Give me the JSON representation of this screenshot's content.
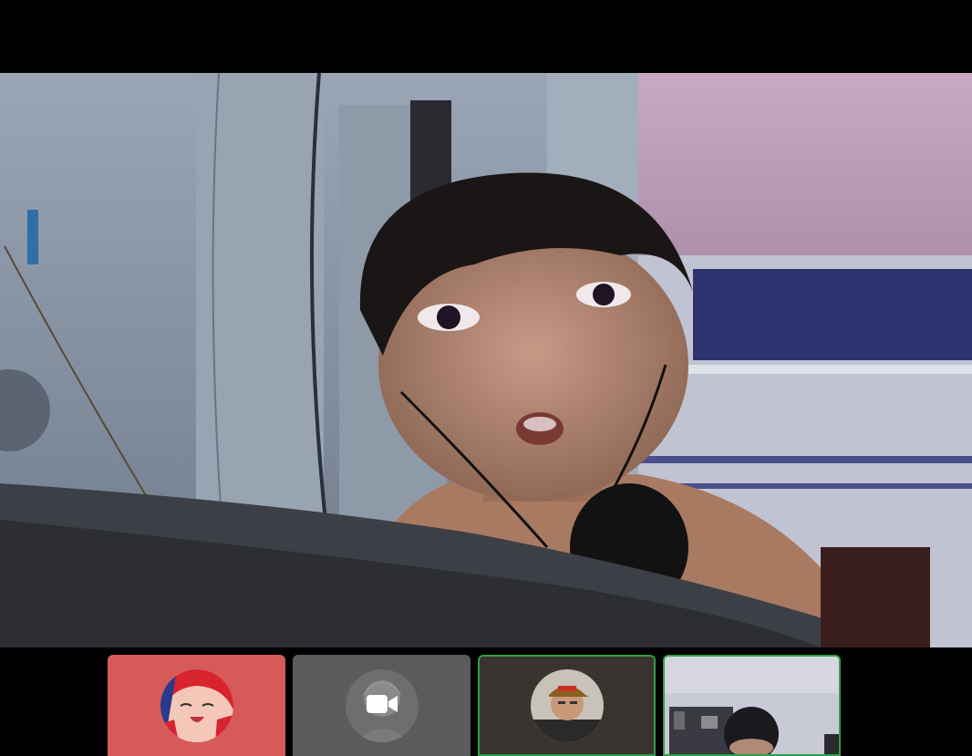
{
  "meeting": {
    "main_participant": "camera-feed-main",
    "participants": [
      {
        "id": "p1",
        "tile_color": "#d65a5a",
        "avatar": "anime-girl-avatar",
        "camera_on": false,
        "speaking": false
      },
      {
        "id": "p2",
        "tile_color": "#5b5b5b",
        "avatar": "grayscale-avatar",
        "camera_on": false,
        "camera_icon": "video-camera-icon",
        "speaking": false
      },
      {
        "id": "p3",
        "tile_color": "#3a3430",
        "avatar": "cap-person-avatar",
        "camera_on": false,
        "speaking": true
      },
      {
        "id": "p4",
        "tile_color": "#c9ccd8",
        "avatar": "live-camera-thumbnail",
        "camera_on": true,
        "speaking": true
      }
    ],
    "accent_speaking": "#2ea043"
  }
}
